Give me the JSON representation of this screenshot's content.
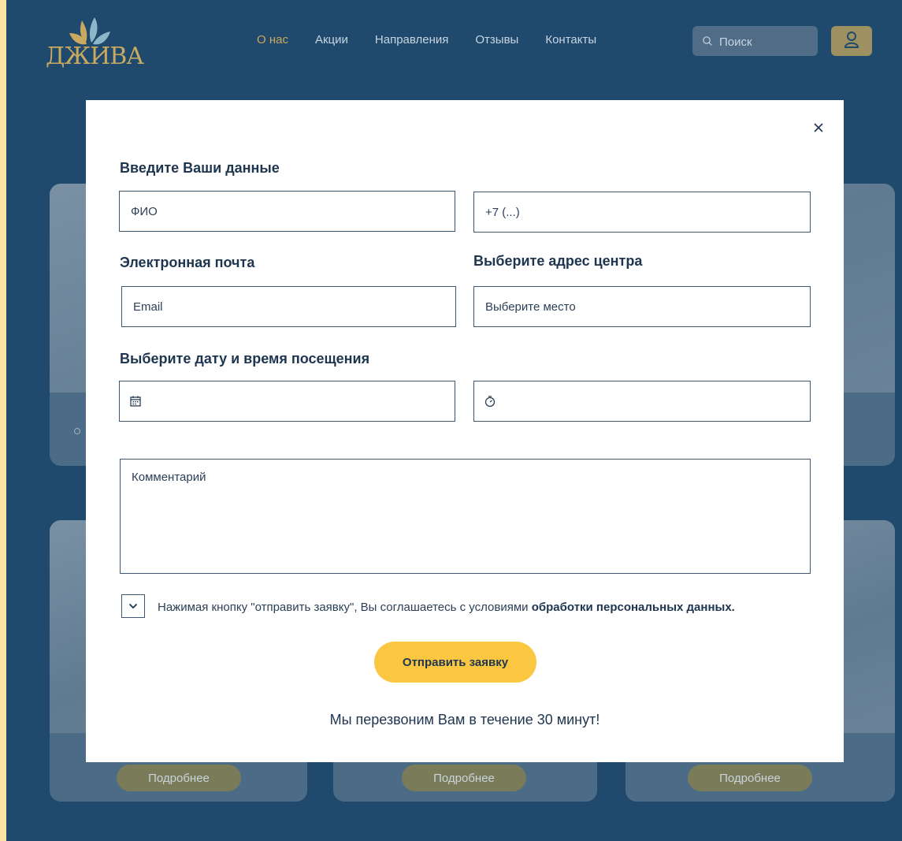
{
  "brand": {
    "logo_text": "ДЖИВА"
  },
  "nav": {
    "items": [
      {
        "label": "О нас"
      },
      {
        "label": "Акции"
      },
      {
        "label": "Направления"
      },
      {
        "label": "Отзывы"
      },
      {
        "label": "Контакты"
      }
    ],
    "active": "О нас"
  },
  "search": {
    "placeholder": "Поиск"
  },
  "background": {
    "more_buttons": [
      "Подробнее",
      "Подробнее",
      "Подробнее"
    ]
  },
  "modal": {
    "close_glyph": "×",
    "title": "Введите Ваши данные",
    "fio_placeholder": "ФИО",
    "phone_placeholder": "+7 (...)",
    "email_label": "Электронная почта",
    "email_placeholder": "Email",
    "address_label": "Выберите адрес центра",
    "address_placeholder": "Выберите место",
    "datetime_label": "Выберите дату и время посещения",
    "comment_placeholder": "Комментарий",
    "consent_text": "Нажимая кнопку \"отправить заявку\", Вы соглашаетесь с условиями ",
    "consent_link": "обработки персональных данных.",
    "submit_label": "Отправить заявку",
    "callback_text": "Мы перезвоним Вам в течение 30 минут!"
  },
  "colors": {
    "page_bg": "#1f4a6d",
    "accent": "#fbc640",
    "gold": "#c9a860",
    "outer_border": "#fbe3a6"
  }
}
